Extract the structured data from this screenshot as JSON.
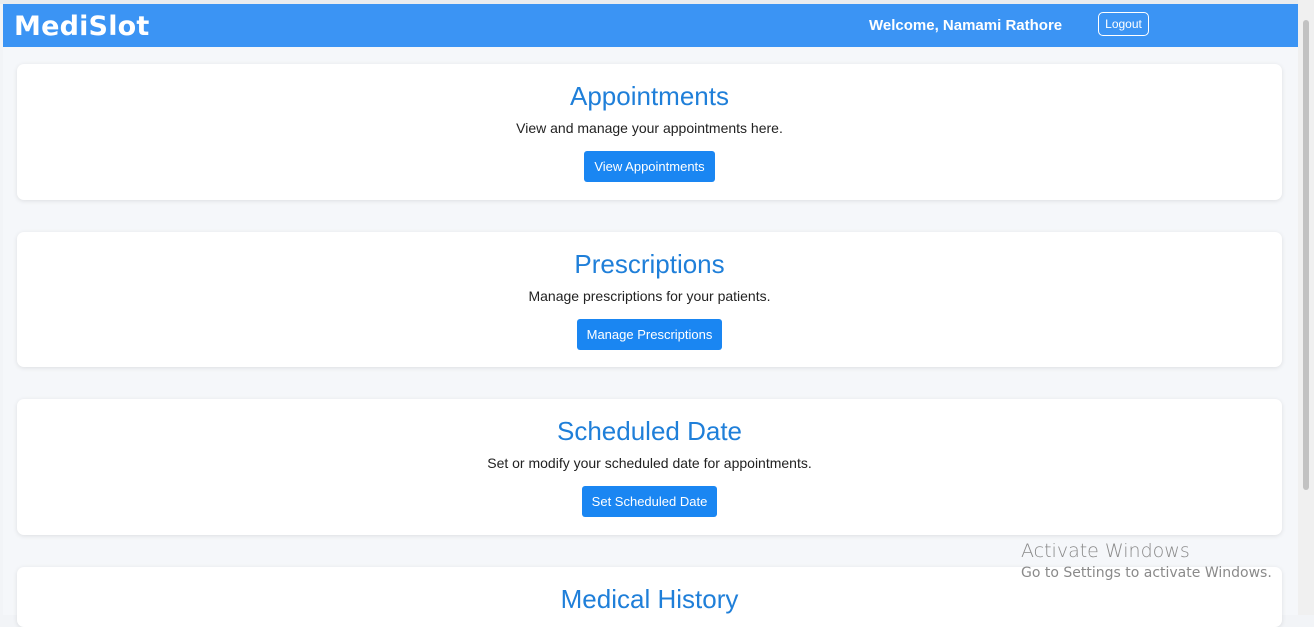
{
  "header": {
    "brand": "MediSlot",
    "welcome_text": "Welcome, Namami Rathore",
    "logout_label": "Logout"
  },
  "cards": [
    {
      "title": "Appointments",
      "description": "View and manage your appointments here.",
      "button_label": "View Appointments"
    },
    {
      "title": "Prescriptions",
      "description": "Manage prescriptions for your patients.",
      "button_label": "Manage Prescriptions"
    },
    {
      "title": "Scheduled Date",
      "description": "Set or modify your scheduled date for appointments.",
      "button_label": "Set Scheduled Date"
    },
    {
      "title": "Medical History"
    }
  ],
  "watermark": {
    "title": "Activate Windows",
    "subtitle": "Go to Settings to activate Windows."
  },
  "colors": {
    "navbar": "#3b94f4",
    "accent": "#1f7fd9",
    "button": "#1a86f2"
  }
}
